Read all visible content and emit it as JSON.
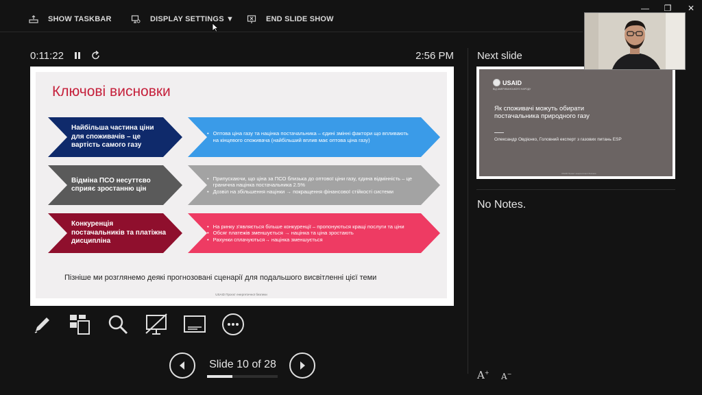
{
  "taskbar": {
    "show_taskbar": "SHOW TASKBAR",
    "display_settings": "DISPLAY SETTINGS ▼",
    "end_slide_show": "END SLIDE SHOW"
  },
  "status": {
    "timer": "0:11:22",
    "clock": "2:56 PM"
  },
  "slide": {
    "title": "Ключові висновки",
    "rows": [
      {
        "headline": "Найбільша частина ціни для споживачів – це вартість самого газу",
        "bullets": [
          "Оптова ціна газу та націнка постачальника – єдині змінні фактори що впливають на кінцевого споживача (найбільший вплив має оптова ціна газу)"
        ],
        "dark_color": "#0f2a6b",
        "light_color": "#3a9be8"
      },
      {
        "headline": "Відміна ПСО несуттєво сприяє зростанню цін",
        "bullets": [
          "Припускаючи, що ціна за ПСО близька до оптової ціни газу, єдина відмінність – це гранична націнка постачальника 2.5%",
          "Дозвіл на збільшення націнки → покращення фінансової стійкості системи"
        ],
        "dark_color": "#5a5a5a",
        "light_color": "#a3a3a3"
      },
      {
        "headline": "Конкуренція постачальників та платіжна дисципліна",
        "bullets": [
          "На ринку з'являється більше конкуренції – пропонуються кращі послуги та ціни",
          "Обсяг платежів зменшується → націнка та ціна зростають",
          "Рахунки сплачуються→ націнка зменшується"
        ],
        "dark_color": "#8f0f2d",
        "light_color": "#ee3b63"
      }
    ],
    "footer": "Пізніше ми розглянемо деякі прогнозовані сценарії для подальшого висвітленні цієї теми",
    "note": "USAID Проєкт енергетичної безпеки"
  },
  "navigation": {
    "slide_counter": "Slide 10 of 28",
    "current": 10,
    "total": 28
  },
  "next_slide": {
    "label": "Next slide",
    "logo": "USAID",
    "logo_sub": "ВІД АМЕРИКАНСЬКОГО НАРОДУ",
    "title": "Як споживачі можуть обирати постачальника природного газу",
    "author": "Олександр Овдієнко, Головний експерт з газових питань ESP",
    "foot": "USAID Проєкт енергетичної безпеки"
  },
  "notes": {
    "text": "No Notes."
  },
  "window": {
    "minimize": "—",
    "restore": "❐",
    "close": "✕"
  },
  "icons": {
    "taskbar": "taskbar-icon",
    "display_settings": "display-settings-icon",
    "end_show": "end-slideshow-icon",
    "pause": "pause-icon",
    "reset": "reset-icon",
    "pen": "pen-icon",
    "all_slides": "see-all-slides-icon",
    "zoom": "zoom-icon",
    "black_screen": "black-screen-icon",
    "subtitles": "subtitles-icon",
    "more": "more-options-icon",
    "prev": "previous-arrow-icon",
    "next": "next-arrow-icon",
    "font_larger": "increase-font-icon",
    "font_smaller": "decrease-font-icon"
  }
}
